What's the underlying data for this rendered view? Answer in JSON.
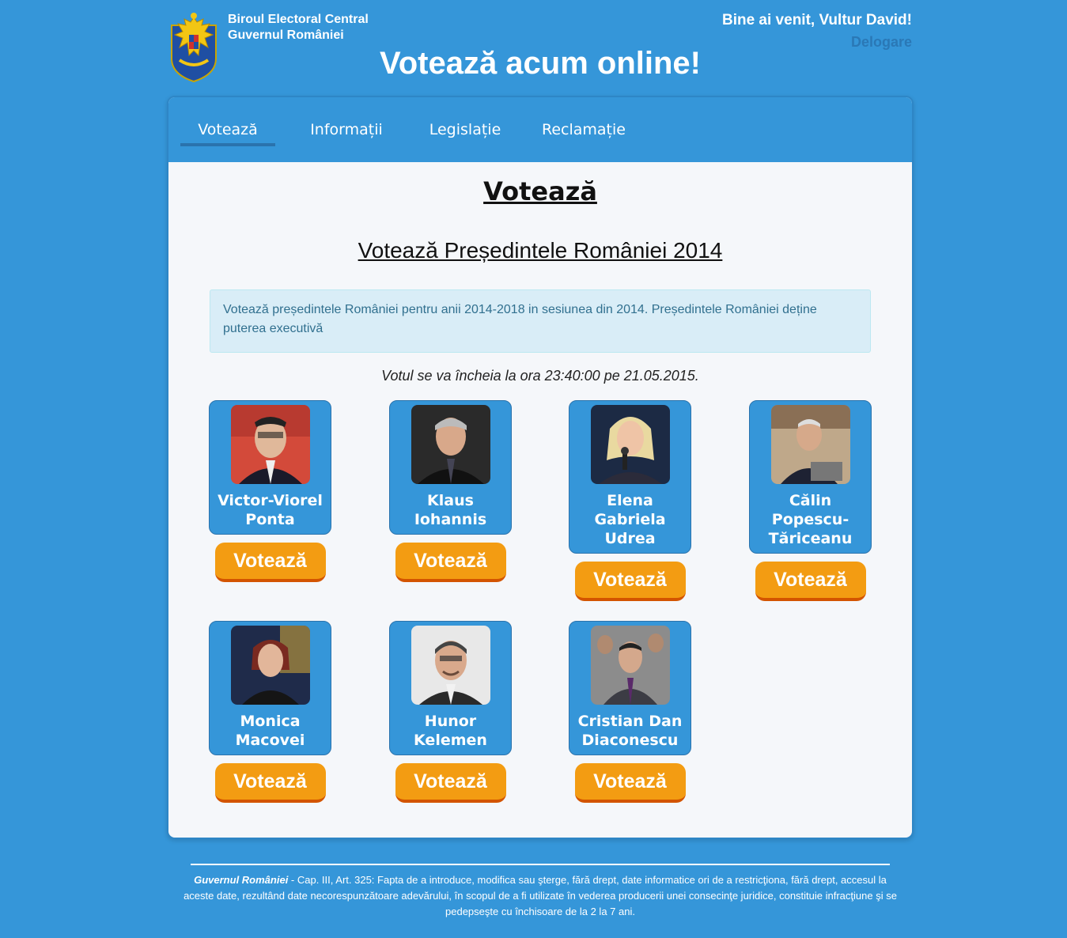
{
  "header": {
    "org_line1": "Biroul Electoral Central",
    "org_line2": "Guvernul României",
    "welcome_prefix": "Bine ai venit,",
    "user_name": "Vultur David!",
    "logout": "Delogare",
    "site_title": "Votează acum online!"
  },
  "nav": [
    {
      "label": "Votează",
      "active": true
    },
    {
      "label": "Informații",
      "active": false
    },
    {
      "label": "Legislație",
      "active": false
    },
    {
      "label": "Reclamație",
      "active": false
    }
  ],
  "main": {
    "heading": "Votează",
    "subheading": "Votează Președintele României 2014",
    "info": "Votează președintele României pentru anii 2014-2018 in sesiunea din 2014. Președintele României deține puterea executivă",
    "deadline": "Votul se va încheia la ora 23:40:00 pe 21.05.2015.",
    "vote_label": "Votează"
  },
  "candidates": [
    {
      "line1": "Victor-Viorel",
      "line2": "Ponta",
      "line3": ""
    },
    {
      "line1": "Klaus",
      "line2": "Iohannis",
      "line3": ""
    },
    {
      "line1": "Elena",
      "line2": "Gabriela",
      "line3": "Udrea"
    },
    {
      "line1": "Călin",
      "line2": "Popescu-",
      "line3": "Tăriceanu"
    },
    {
      "line1": "Monica",
      "line2": "Macovei",
      "line3": ""
    },
    {
      "line1": "Hunor",
      "line2": "Kelemen",
      "line3": ""
    },
    {
      "line1": "Cristian Dan",
      "line2": "Diaconescu",
      "line3": ""
    }
  ],
  "footer": {
    "gov": "Guvernul României",
    "text": " - Cap. III, Art. 325: Fapta de a introduce, modifica sau şterge, fără drept, date informatice ori de a restricţiona, fără drept, accesul la aceste date, rezultând date necorespunzătoare adevărului, în scopul de a fi utilizate în vederea producerii unei consecinţe juridice, constituie infracţiune şi se pedepseşte cu închisoare de la 2 la 7 ani."
  },
  "colors": {
    "background": "#3596d9",
    "vote_button": "#f39c12",
    "vote_button_shadow": "#d35400",
    "info_bg": "#d9edf7"
  }
}
